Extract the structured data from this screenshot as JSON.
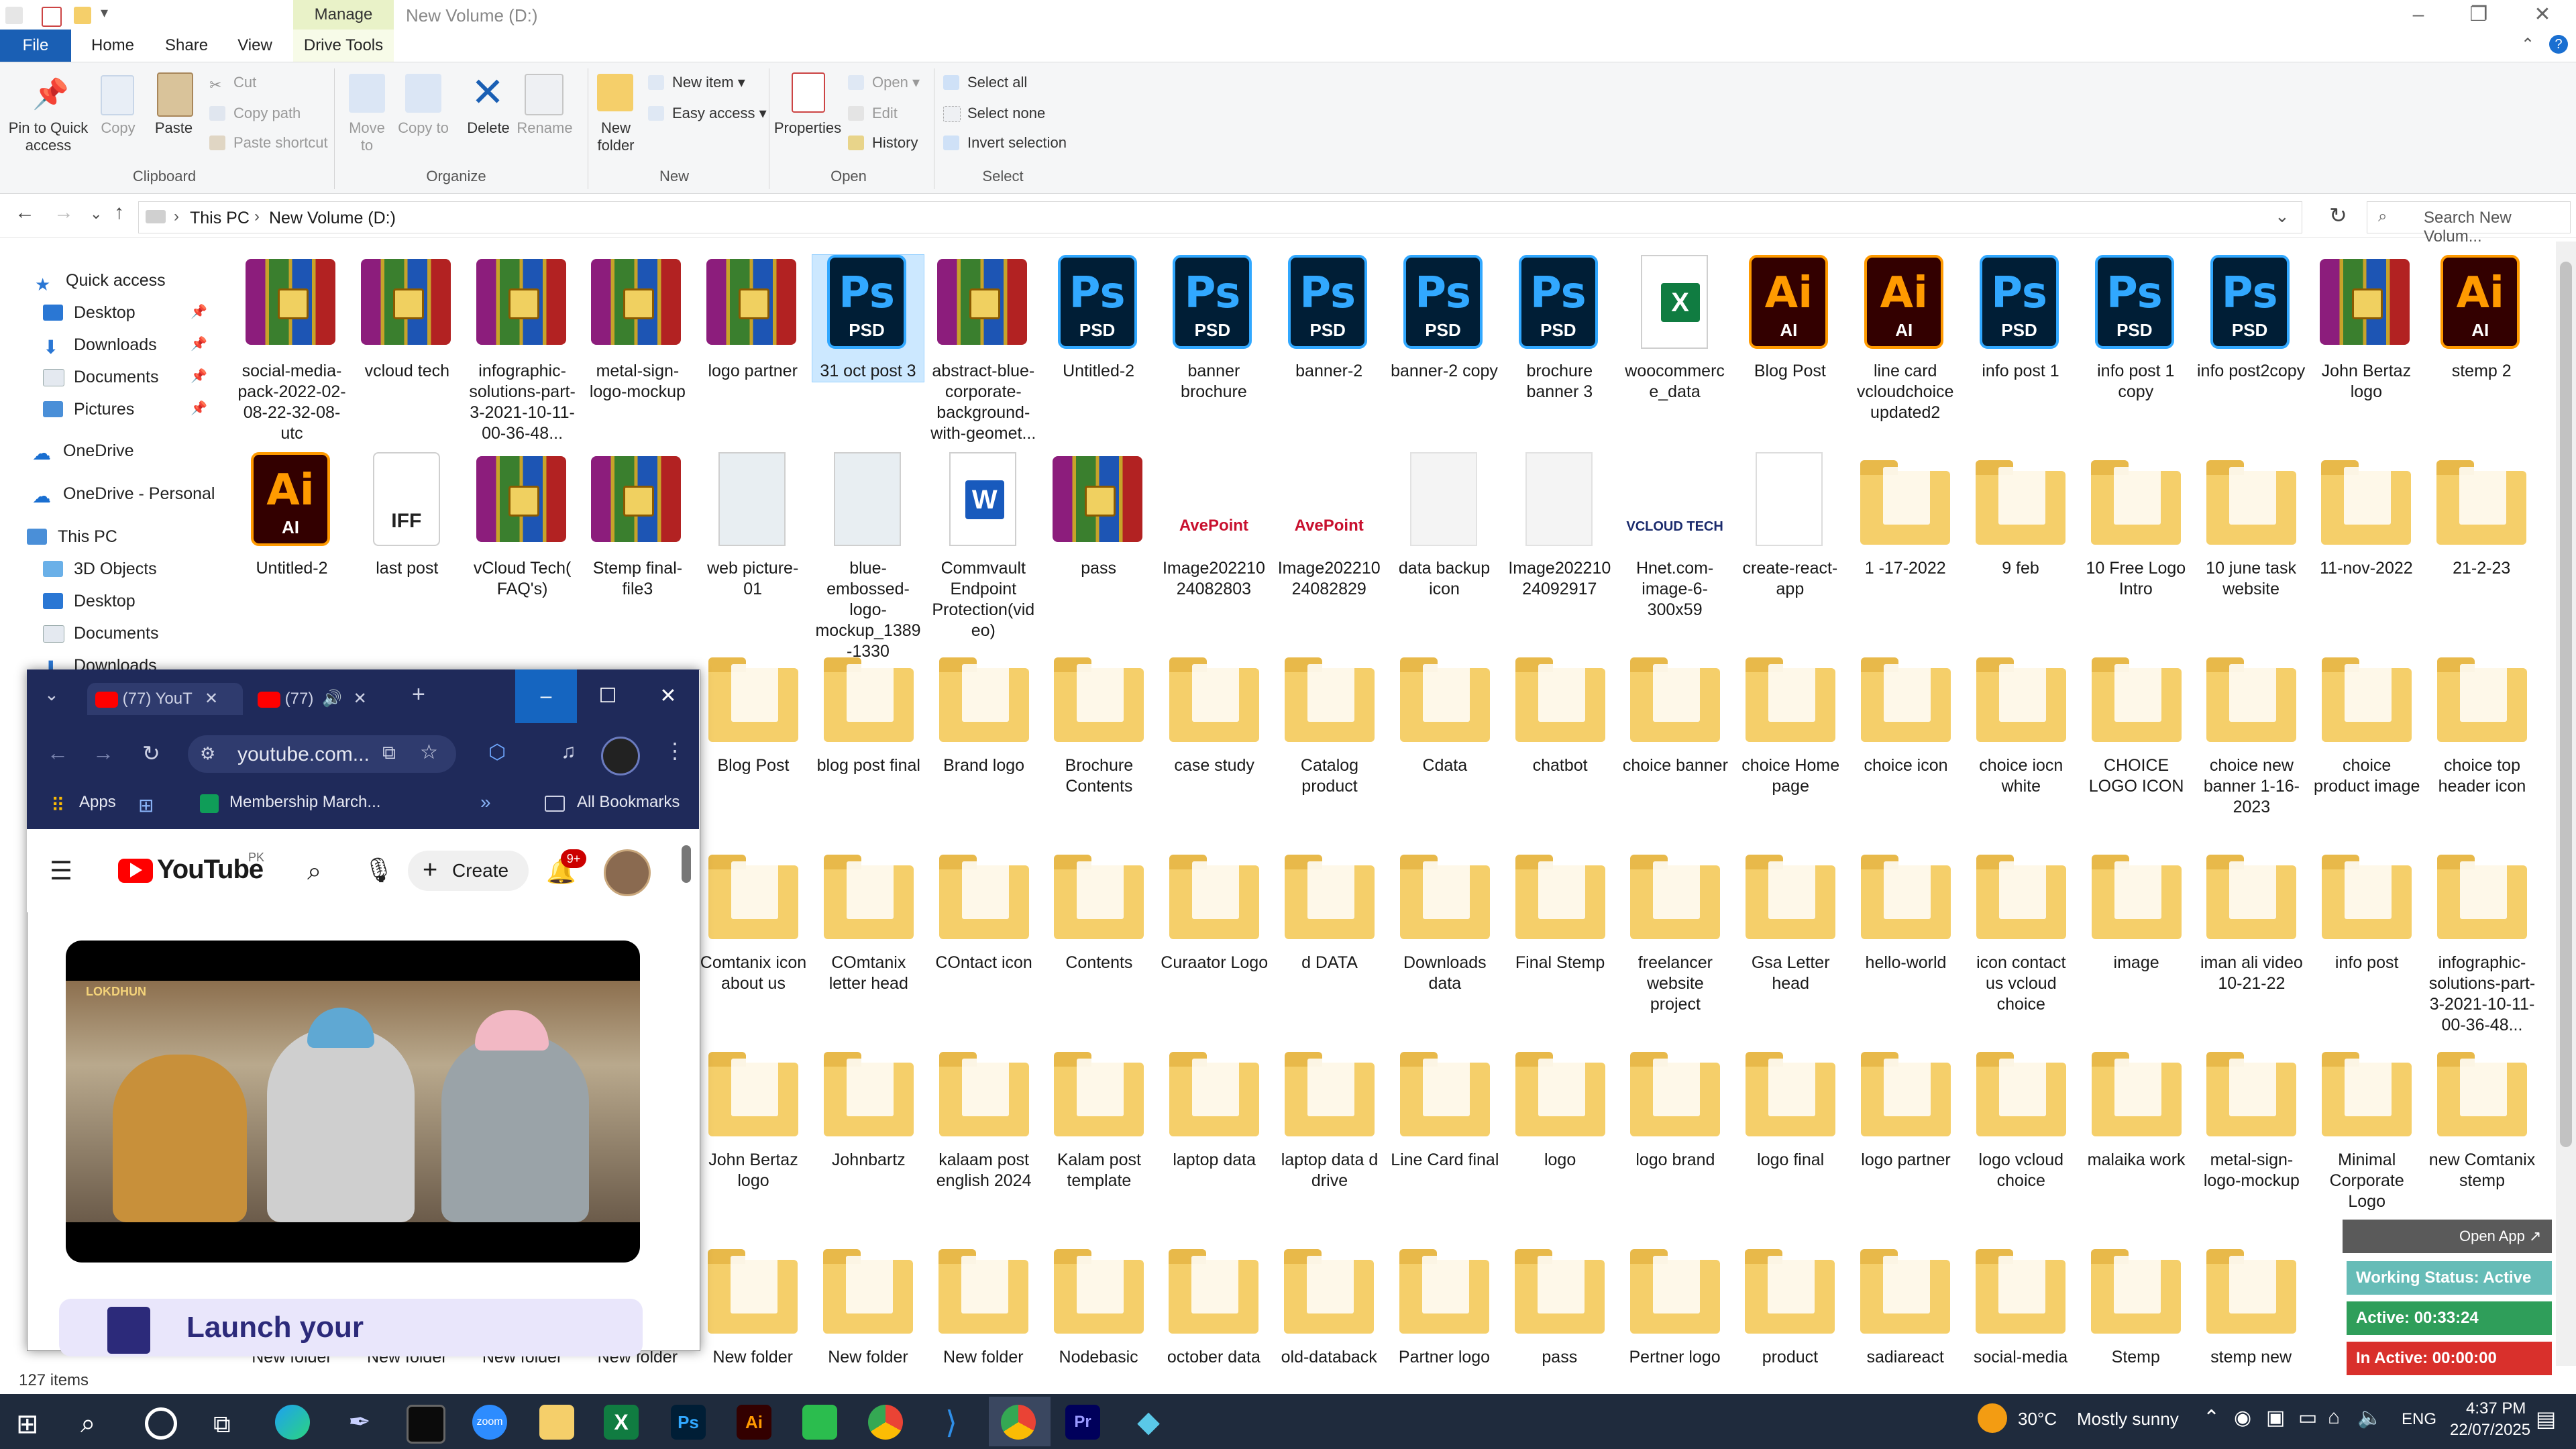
{
  "window": {
    "title": "New Volume (D:)",
    "context_tab": "Manage",
    "context_sub_tab": "Drive Tools"
  },
  "ribbon_tabs": [
    "File",
    "Home",
    "Share",
    "View"
  ],
  "ribbon": {
    "clipboard": {
      "pin": "Pin to Quick access",
      "copy": "Copy",
      "paste": "Paste",
      "cut": "Cut",
      "copy_path": "Copy path",
      "paste_shortcut": "Paste shortcut",
      "label": "Clipboard"
    },
    "organize": {
      "move_to": "Move to",
      "copy_to": "Copy to",
      "delete": "Delete",
      "rename": "Rename",
      "label": "Organize"
    },
    "new": {
      "new_folder": "New folder",
      "new_item": "New item",
      "easy_access": "Easy access",
      "label": "New"
    },
    "open": {
      "properties": "Properties",
      "open": "Open",
      "edit": "Edit",
      "history": "History",
      "label": "Open"
    },
    "select": {
      "select_all": "Select all",
      "select_none": "Select none",
      "invert": "Invert selection",
      "label": "Select"
    }
  },
  "address": {
    "crumbs": [
      "This PC",
      "New Volume (D:)"
    ],
    "search_placeholder": "Search New Volum..."
  },
  "nav": {
    "quick_access": "Quick access",
    "quick_items": [
      "Desktop",
      "Downloads",
      "Documents",
      "Pictures"
    ],
    "onedrive": "OneDrive",
    "onedrive_personal": "OneDrive - Personal",
    "this_pc": "This PC",
    "pc_items": [
      "3D Objects",
      "Desktop",
      "Documents",
      "Downloads"
    ]
  },
  "files": [
    {
      "name": "social-media-pack-2022-02-08-22-32-08-utc",
      "type": "rar"
    },
    {
      "name": "vcloud tech",
      "type": "rar"
    },
    {
      "name": "infographic-solutions-part-3-2021-10-11-00-36-48...",
      "type": "rar"
    },
    {
      "name": "metal-sign-logo-mockup",
      "type": "rar"
    },
    {
      "name": "logo partner",
      "type": "rar"
    },
    {
      "name": "31 oct post 3",
      "type": "psd"
    },
    {
      "name": "abstract-blue-corporate-background-with-geomet...",
      "type": "rar"
    },
    {
      "name": "Untitled-2",
      "type": "psd"
    },
    {
      "name": "banner brochure",
      "type": "psd"
    },
    {
      "name": "banner-2",
      "type": "psd"
    },
    {
      "name": "banner-2 copy",
      "type": "psd"
    },
    {
      "name": "brochure banner 3",
      "type": "psd"
    },
    {
      "name": "woocommerce_data",
      "type": "xls"
    },
    {
      "name": "Blog Post",
      "type": "ai"
    },
    {
      "name": "line card vcloudchoice updated2",
      "type": "ai"
    },
    {
      "name": "info post 1",
      "type": "psd"
    },
    {
      "name": "info post 1 copy",
      "type": "psd"
    },
    {
      "name": "info post2copy",
      "type": "psd"
    },
    {
      "name": "John Bertaz logo",
      "type": "rar"
    },
    {
      "name": "stemp 2",
      "type": "ai"
    },
    {
      "name": "Untitled-2",
      "type": "ai"
    },
    {
      "name": "last post",
      "type": "iff"
    },
    {
      "name": "vCloud Tech( FAQ's)",
      "type": "rar"
    },
    {
      "name": "Stemp final-file3",
      "type": "rar"
    },
    {
      "name": "web picture-01",
      "type": "img"
    },
    {
      "name": "blue-embossed-logo-mockup_1389-1330",
      "type": "img"
    },
    {
      "name": "Commvault Endpoint Protection(video)",
      "type": "word"
    },
    {
      "name": "pass",
      "type": "rar"
    },
    {
      "name": "Image20221024082803",
      "type": "avepoint"
    },
    {
      "name": "Image20221024082829",
      "type": "avepoint"
    },
    {
      "name": "data backup icon",
      "type": "blank"
    },
    {
      "name": "Image20221024092917",
      "type": "blank"
    },
    {
      "name": "Hnet.com-image-6-300x59",
      "type": "vcloud"
    },
    {
      "name": "create-react-app",
      "type": "doc"
    },
    {
      "name": "1 -17-2022",
      "type": "folder"
    },
    {
      "name": "9 feb",
      "type": "folder"
    },
    {
      "name": "10 Free Logo Intro",
      "type": "folder"
    },
    {
      "name": "10 june task website",
      "type": "folder"
    },
    {
      "name": "11-nov-2022",
      "type": "folder"
    },
    {
      "name": "21-2-23",
      "type": "folder"
    },
    {
      "name": "Blog Post",
      "type": "folder"
    },
    {
      "name": "blog post final",
      "type": "folder"
    },
    {
      "name": "Brand logo",
      "type": "folder"
    },
    {
      "name": "Brochure Contents",
      "type": "folder"
    },
    {
      "name": "case study",
      "type": "folder"
    },
    {
      "name": "Catalog product",
      "type": "folder"
    },
    {
      "name": "Cdata",
      "type": "folder"
    },
    {
      "name": "chatbot",
      "type": "folder"
    },
    {
      "name": "choice banner",
      "type": "folder"
    },
    {
      "name": "choice Home page",
      "type": "folder"
    },
    {
      "name": "choice icon",
      "type": "folder"
    },
    {
      "name": "choice iocn white",
      "type": "folder"
    },
    {
      "name": "CHOICE LOGO ICON",
      "type": "folder"
    },
    {
      "name": "choice new banner 1-16-2023",
      "type": "folder"
    },
    {
      "name": "choice product image",
      "type": "folder"
    },
    {
      "name": "choice top header icon",
      "type": "folder"
    },
    {
      "name": "Comtanix icon about us",
      "type": "folder"
    },
    {
      "name": "COmtanix letter head",
      "type": "folder"
    },
    {
      "name": "COntact icon",
      "type": "folder"
    },
    {
      "name": "Contents",
      "type": "folder"
    },
    {
      "name": "Curaator Logo",
      "type": "folder"
    },
    {
      "name": "d DATA",
      "type": "folder"
    },
    {
      "name": "Downloads data",
      "type": "folder"
    },
    {
      "name": "Final Stemp",
      "type": "folder"
    },
    {
      "name": "freelancer website project",
      "type": "folder"
    },
    {
      "name": "Gsa Letter head",
      "type": "folder"
    },
    {
      "name": "hello-world",
      "type": "folder"
    },
    {
      "name": "icon contact us vcloud choice",
      "type": "folder"
    },
    {
      "name": "image",
      "type": "folder"
    },
    {
      "name": "iman ali video 10-21-22",
      "type": "folder"
    },
    {
      "name": "info post",
      "type": "folder"
    },
    {
      "name": "infographic-solutions-part-3-2021-10-11-00-36-48...",
      "type": "folder"
    },
    {
      "name": "John Bertaz logo",
      "type": "folder"
    },
    {
      "name": "Johnbartz",
      "type": "folder"
    },
    {
      "name": "kalaam post english 2024",
      "type": "folder"
    },
    {
      "name": "Kalam post template",
      "type": "folder"
    },
    {
      "name": "laptop data",
      "type": "folder"
    },
    {
      "name": "laptop data d drive",
      "type": "folder"
    },
    {
      "name": "Line Card final",
      "type": "folder"
    },
    {
      "name": "logo",
      "type": "folder"
    },
    {
      "name": "logo brand",
      "type": "folder"
    },
    {
      "name": "logo final",
      "type": "folder"
    },
    {
      "name": "logo partner",
      "type": "folder"
    },
    {
      "name": "logo vcloud choice",
      "type": "folder"
    },
    {
      "name": "malaika work",
      "type": "folder"
    },
    {
      "name": "metal-sign-logo-mockup",
      "type": "folder"
    },
    {
      "name": "Minimal Corporate Logo",
      "type": "folder"
    },
    {
      "name": "new Comtanix stemp",
      "type": "folder"
    },
    {
      "name": "New folder",
      "type": "folder"
    },
    {
      "name": "New folder",
      "type": "folder"
    },
    {
      "name": "New folder",
      "type": "folder"
    },
    {
      "name": "New folder",
      "type": "folder"
    },
    {
      "name": "New folder",
      "type": "folder"
    },
    {
      "name": "New folder",
      "type": "folder"
    },
    {
      "name": "New folder",
      "type": "folder"
    },
    {
      "name": "Nodebasic",
      "type": "folder"
    },
    {
      "name": "october data",
      "type": "folder"
    },
    {
      "name": "old-databack",
      "type": "folder"
    },
    {
      "name": "Partner logo",
      "type": "folder"
    },
    {
      "name": "pass",
      "type": "folder"
    },
    {
      "name": "Pertner logo",
      "type": "folder"
    },
    {
      "name": "product",
      "type": "folder"
    },
    {
      "name": "sadiareact",
      "type": "folder"
    },
    {
      "name": "social-media",
      "type": "folder"
    },
    {
      "name": "Stemp",
      "type": "folder"
    },
    {
      "name": "stemp new",
      "type": "folder"
    }
  ],
  "selected_file": "31 oct post 3",
  "status": {
    "item_count": "127 items"
  },
  "chrome": {
    "tabs": [
      "(77) YouT",
      "(77) "
    ],
    "new_tab": "+",
    "url": "youtube.com...",
    "bookmarks": [
      "Apps",
      "Membership March...",
      "All Bookmarks"
    ],
    "youtube": {
      "logo_text": "YouTube",
      "region": "PK",
      "create": "Create",
      "notif_count": "9+",
      "video_channel": "LOKDHUN",
      "ad_text": "Launch your"
    }
  },
  "tracker": {
    "open_app": "Open App ↗",
    "working_status": "Working Status: Active",
    "active": "Active: 00:33:24",
    "inactive": "In Active: 00:00:00"
  },
  "taskbar": {
    "weather_temp": "30°C",
    "weather_text": "Mostly sunny",
    "lang": "ENG",
    "time": "4:37 PM",
    "date": "22/07/2025"
  },
  "colors": {
    "accent": "#1a6fd1",
    "file_tab": "#1a5fb4",
    "manage_tab": "#e9f2c8",
    "selection": "#cce8ff",
    "taskbar": "#1f2b3d",
    "chrome_frame": "#1f2a5a",
    "tracker_green": "#2f9e5a",
    "tracker_red": "#d9302c"
  }
}
